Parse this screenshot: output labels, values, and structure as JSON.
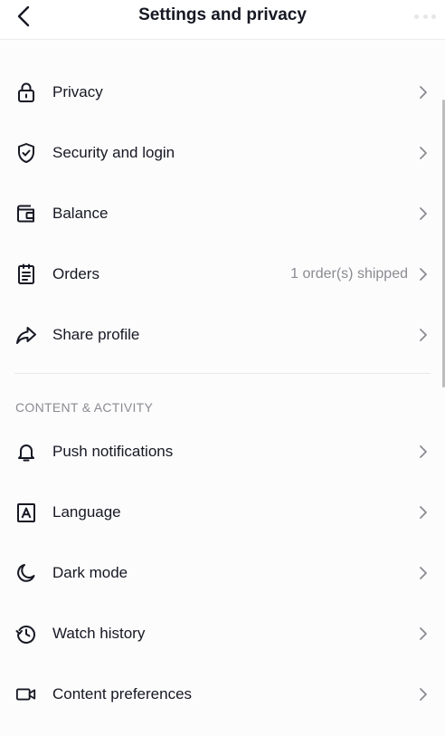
{
  "header": {
    "title": "Settings and privacy"
  },
  "account_items": [
    {
      "label": "Privacy",
      "icon": "lock-icon",
      "value": ""
    },
    {
      "label": "Security and login",
      "icon": "shield-icon",
      "value": ""
    },
    {
      "label": "Balance",
      "icon": "wallet-icon",
      "value": ""
    },
    {
      "label": "Orders",
      "icon": "clipboard-icon",
      "value": "1 order(s) shipped"
    },
    {
      "label": "Share profile",
      "icon": "share-icon",
      "value": ""
    }
  ],
  "content_section": {
    "title": "CONTENT & ACTIVITY",
    "items": [
      {
        "label": "Push notifications",
        "icon": "bell-icon"
      },
      {
        "label": "Language",
        "icon": "language-icon"
      },
      {
        "label": "Dark mode",
        "icon": "moon-icon"
      },
      {
        "label": "Watch history",
        "icon": "history-icon"
      },
      {
        "label": "Content preferences",
        "icon": "video-camera-icon"
      }
    ]
  },
  "colors": {
    "text": "#161823",
    "secondary_text": "#8a8b91",
    "chevron": "#8a8b91",
    "divider": "#e9e9ea"
  }
}
